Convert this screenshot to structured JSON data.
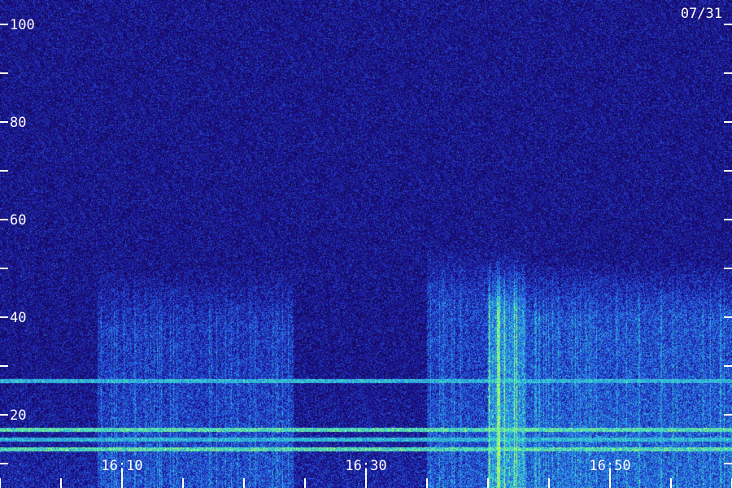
{
  "date_label": "07/31",
  "chart_data": {
    "type": "heatmap",
    "y_ticks": [
      "100",
      "80",
      "60",
      "40",
      "20"
    ],
    "y_tick_values": [
      100,
      80,
      60,
      40,
      20
    ],
    "y_minor_values": [
      90,
      70,
      50,
      30,
      10
    ],
    "ylim": [
      0,
      100
    ],
    "x_ticks": [
      "16:10",
      "16:30",
      "16:50"
    ],
    "x_tick_minutes": [
      10,
      30,
      50
    ],
    "xlim_minutes": [
      2,
      62
    ],
    "x_minor_step_minutes": 5,
    "colors": {
      "background": "#12085a",
      "low": "#1c12b8",
      "mid": "#2a6cf0",
      "high": "#37e6c8",
      "peak": "#c8ff50"
    },
    "bands": [
      {
        "freq": 27,
        "level": "high"
      },
      {
        "freq": 17,
        "level": "peak"
      },
      {
        "freq": 15,
        "level": "high"
      },
      {
        "freq": 13,
        "level": "peak"
      }
    ],
    "activity_regions": [
      {
        "start_minute": 8,
        "end_minute": 24,
        "freq_max": 50,
        "intensity": 0.45
      },
      {
        "start_minute": 35,
        "end_minute": 43,
        "freq_max": 55,
        "intensity": 0.55
      },
      {
        "start_minute": 40,
        "end_minute": 60,
        "freq_max": 52,
        "intensity": 0.75
      }
    ]
  }
}
